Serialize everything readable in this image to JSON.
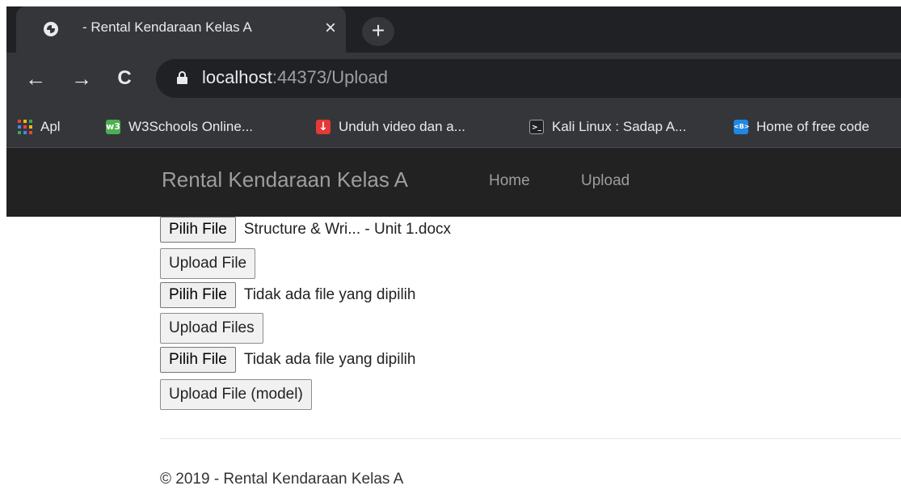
{
  "browser": {
    "tab_title": "- Rental Kendaraan Kelas A",
    "tab_close": "×",
    "new_tab": "+",
    "back": "←",
    "forward": "→",
    "reload": "C",
    "url_host": "localhost",
    "url_rest": ":44373/Upload",
    "bookmarks": [
      {
        "label": "Apl",
        "icon": "apps-grid-icon"
      },
      {
        "label": "W3Schools Online...",
        "icon": "w3",
        "color": "#4caf50"
      },
      {
        "label": "Unduh video dan a...",
        "icon": "↓",
        "color": "#e53935"
      },
      {
        "label": "Kali Linux : Sadap A...",
        "icon": ">_",
        "color": "#202124"
      },
      {
        "label": "Home of free code",
        "icon": "<B>",
        "color": "#1e88e5"
      }
    ]
  },
  "navbar": {
    "brand": "Rental Kendaraan Kelas A",
    "links": [
      "Home",
      "Upload"
    ]
  },
  "forms": {
    "file1": {
      "button": "Pilih File",
      "filename": "Structure & Wri... - Unit 1.docx"
    },
    "upload1": "Upload File",
    "file2": {
      "button": "Pilih File",
      "filename": "Tidak ada file yang dipilih"
    },
    "upload2": "Upload Files",
    "file3": {
      "button": "Pilih File",
      "filename": "Tidak ada file yang dipilih"
    },
    "upload3": "Upload File (model)"
  },
  "footer": {
    "text": "© 2019 - Rental Kendaraan Kelas A"
  },
  "colors": {
    "navbar_bg": "#222222",
    "navbar_text": "#9d9d9d",
    "chrome_dark": "#202124",
    "chrome_toolbar": "#35363a"
  }
}
